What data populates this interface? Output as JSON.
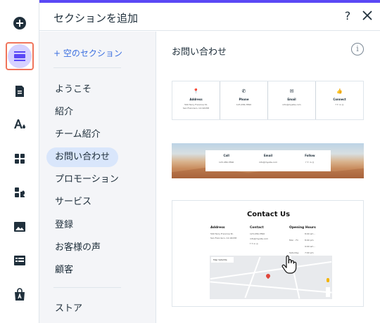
{
  "rail": {
    "items": [
      {
        "name": "add-elements-icon"
      },
      {
        "name": "add-section-icon",
        "active": true
      },
      {
        "name": "pages-icon"
      },
      {
        "name": "design-icon"
      },
      {
        "name": "apps-grid-icon"
      },
      {
        "name": "app-market-icon"
      },
      {
        "name": "media-icon"
      },
      {
        "name": "cms-table-icon"
      },
      {
        "name": "business-tools-icon"
      }
    ]
  },
  "header": {
    "title": "セクションを追加",
    "help_label": "?"
  },
  "categories": {
    "add_empty": "+ 空のセクション",
    "items": [
      {
        "label": "ようこそ"
      },
      {
        "label": "紹介"
      },
      {
        "label": "チーム紹介"
      },
      {
        "label": "お問い合わせ",
        "selected": true
      },
      {
        "label": "プロモーション"
      },
      {
        "label": "サービス"
      },
      {
        "label": "登録"
      },
      {
        "label": "お客様の声"
      },
      {
        "label": "顧客"
      },
      {
        "label": "ストア"
      }
    ]
  },
  "preview": {
    "title": "お問い合わせ",
    "info_label": "i",
    "card1": {
      "columns": [
        {
          "icon": "📍",
          "label": "Address",
          "text": "500 Terry Francine St.\nSan Francisco, CA 94158"
        },
        {
          "icon": "✆",
          "label": "Phone",
          "text": "123-456-7890"
        },
        {
          "icon": "✉",
          "label": "Email",
          "text": "info@mysite.com"
        },
        {
          "icon": "👍",
          "label": "Connect",
          "text": "f  ✦  in  ◎"
        }
      ]
    },
    "card2": {
      "columns": [
        {
          "label": "Call",
          "text": "123-456-7890"
        },
        {
          "label": "Email",
          "text": "info@mysite.com"
        },
        {
          "label": "Follow",
          "text": "f  ✦  in  ◎"
        }
      ]
    },
    "card3": {
      "title": "Contact Us",
      "address": {
        "label": "Address",
        "text": "500 Terry Francine St.\nSan Francisco, CA 94158"
      },
      "contact": {
        "label": "Contact",
        "lines": [
          "123-456-7890",
          "info@mysite.com",
          "f  ✦  in  ◎"
        ]
      },
      "hours": {
        "label": "Opening Hours",
        "rows": [
          {
            "day": "Mon - Fri",
            "time": "8:00 am – 8:00 pm"
          },
          {
            "day": "Saturday",
            "time": "9:00 am – 7:00 pm"
          },
          {
            "day": "Sunday",
            "time": "9:00 am – 9:00 pm"
          }
        ]
      },
      "map": {
        "tab_map": "Map",
        "tab_sat": "Satellite"
      }
    }
  }
}
